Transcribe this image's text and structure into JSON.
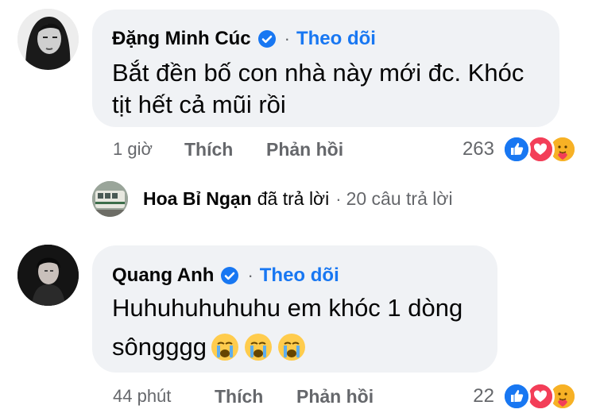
{
  "comments": [
    {
      "author": "Đặng Minh Cúc",
      "verified_icon": "verified-badge-icon",
      "separator": "·",
      "follow_label": "Theo dõi",
      "text_line1": "Bắt đền bố con nhà này mới đc. Khóc",
      "text_line2": "tịt hết cả mũi rồi",
      "time": "1 giờ",
      "like_label": "Thích",
      "reply_label": "Phản hồi",
      "reaction_count": "263",
      "reactions": [
        "like-reaction-icon",
        "love-reaction-icon",
        "care-reaction-icon"
      ]
    },
    {
      "author": "Quang Anh",
      "verified_icon": "verified-badge-icon",
      "separator": "·",
      "follow_label": "Theo dõi",
      "text_line1": "Huhuhuhuhuhu em khóc 1 dòng",
      "text_line2": "sôngggg",
      "text_emojis": [
        "loudly-crying-face-emoji",
        "loudly-crying-face-emoji",
        "loudly-crying-face-emoji"
      ],
      "time": "44 phút",
      "like_label": "Thích",
      "reply_label": "Phản hồi",
      "reaction_count": "22",
      "reactions": [
        "like-reaction-icon",
        "love-reaction-icon",
        "care-reaction-icon"
      ]
    }
  ],
  "reply_summary": {
    "name": "Hoa Bỉ Ngạn",
    "action": "đã trả lời",
    "separator": "·",
    "count": "20 câu trả lời"
  },
  "colors": {
    "accent": "#1877f2",
    "bubble": "#f0f2f5",
    "secondary_text": "#65676b",
    "like": "#1877f2",
    "love": "#f33e58",
    "care": "#f7b125"
  }
}
